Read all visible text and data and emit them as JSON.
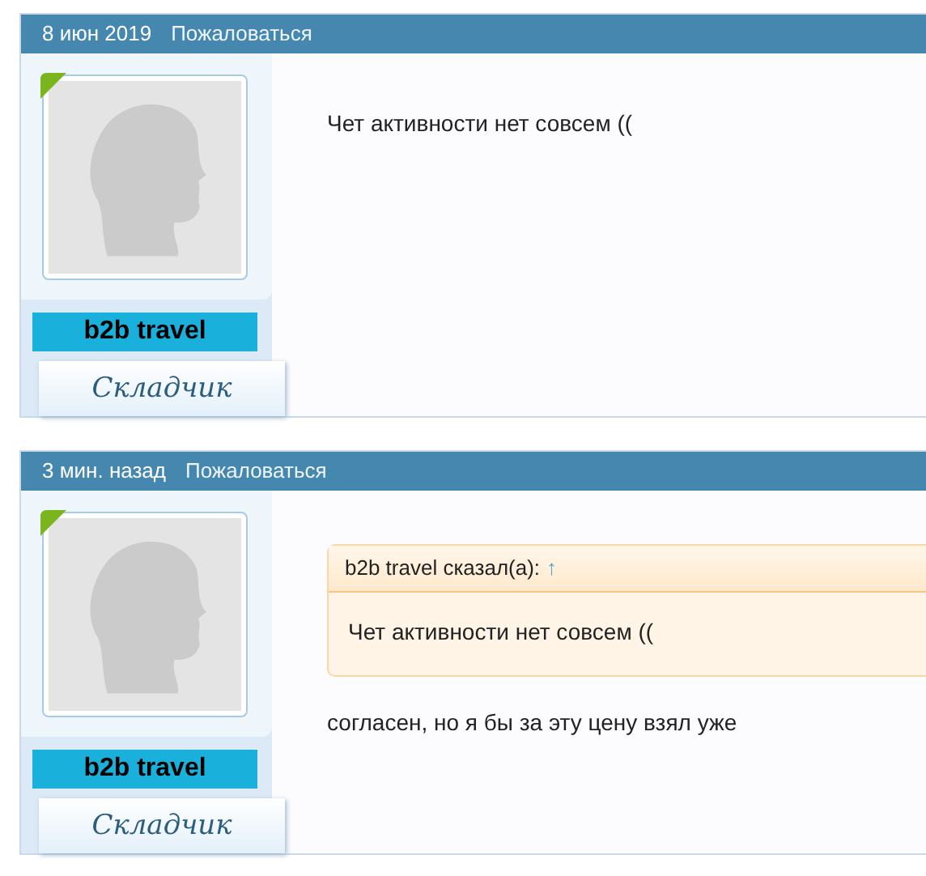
{
  "posts": [
    {
      "date": "8 июн 2019",
      "report": "Пожаловаться",
      "author": "b2b travel",
      "rank": "Складчик",
      "body": "Чет активности нет совсем (("
    },
    {
      "date": "3 мин. назад",
      "report": "Пожаловаться",
      "author": "b2b travel",
      "rank": "Складчик",
      "quote": {
        "attribution": "b2b travel сказал(а):",
        "jump": "↑",
        "text": "Чет активности нет совсем (("
      },
      "body": "согласен, но я бы за эту цену взял уже"
    }
  ]
}
